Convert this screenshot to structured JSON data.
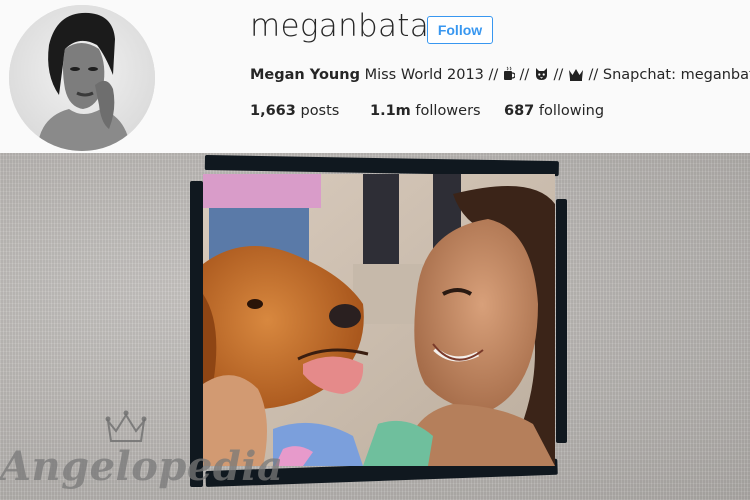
{
  "profile": {
    "username": "meganbata",
    "follow_label": "Follow",
    "bio": {
      "name": "Megan Young",
      "text_1": " Miss World 2013 // ",
      "sep_1": " // ",
      "sep_2": " // ",
      "text_2": " // Snapchat: meganbata",
      "emoji_1": "coffee-cup-icon",
      "emoji_2": "cat-face-icon",
      "emoji_3": "crown-icon"
    },
    "stats": {
      "posts_count": "1,663",
      "posts_label": " posts",
      "followers_count": "1.1m",
      "followers_label": " followers",
      "following_count": "687",
      "following_label": " following"
    }
  },
  "post": {
    "watermark": "Angelopedia",
    "colors": {
      "follow_blue": "#3897f0",
      "frame_dark": "#10181f",
      "wall": "#b8b5b2"
    }
  }
}
